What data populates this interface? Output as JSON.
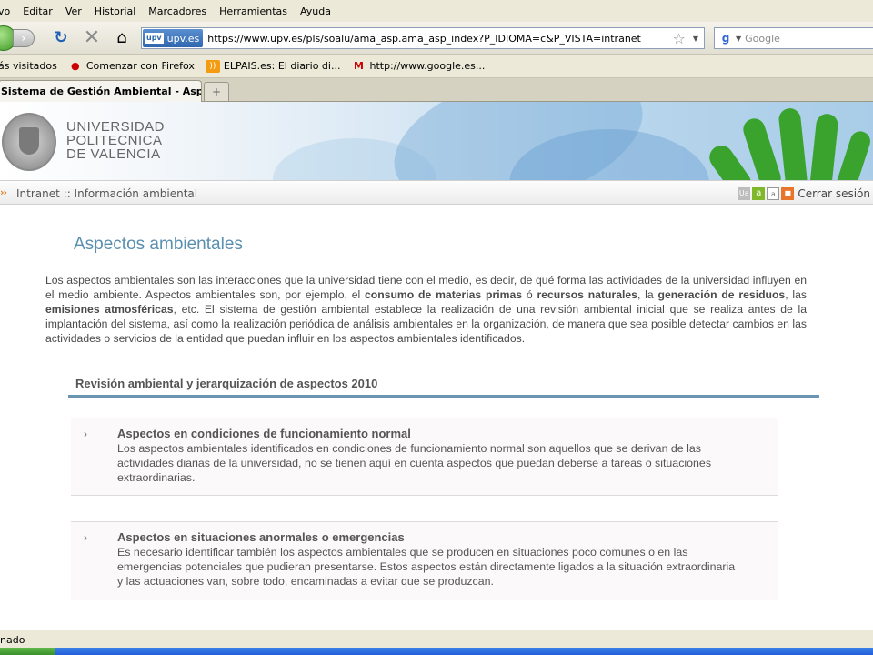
{
  "menu": [
    "vo",
    "Editar",
    "Ver",
    "Historial",
    "Marcadores",
    "Herramientas",
    "Ayuda"
  ],
  "navbar": {
    "site_badge": "upv.es",
    "site_badge_mini": "upv",
    "url": "https://www.upv.es/pls/soalu/ama_asp.ama_asp_index?P_IDIOMA=c&P_VISTA=intranet",
    "search_placeholder": "Google"
  },
  "bookmarks": [
    {
      "label": "ás visitados",
      "icon": "none"
    },
    {
      "label": "Comenzar con Firefox",
      "icon": "firefox-icon"
    },
    {
      "label": "ELPAIS.es: El diario di...",
      "icon": "rss-icon"
    },
    {
      "label": "http://www.google.es...",
      "icon": "gmail-icon"
    }
  ],
  "tab": {
    "title": "Sistema de Gestión Ambiental - Asp...",
    "new_tab": "+"
  },
  "header": {
    "logo_lines": [
      "UNIVERSIDAD",
      "POLITECNICA",
      "DE VALENCIA"
    ]
  },
  "breadcrumb": {
    "arrows": "››",
    "text": "Intranet :: Información ambiental",
    "tools": [
      "Ua",
      "a",
      "a"
    ],
    "logout": "Cerrar sesión"
  },
  "content": {
    "title": "Aspectos ambientales",
    "intro_parts": [
      "Los aspectos ambientales son las interacciones que la universidad tiene con el medio, es decir, de qué forma las actividades de la universidad influyen en el medio ambiente. Aspectos ambientales son, por ejemplo, el ",
      "consumo de materias primas",
      " ó ",
      "recursos naturales",
      ", la ",
      "generación de residuos",
      ", las ",
      "emisiones atmosféricas",
      ", etc. El sistema de gestión ambiental establece la realización de una revisión ambiental inicial que se realiza antes de la implantación del sistema, así como la realización periódica de análisis ambientales en la organización, de manera que sea posible detectar cambios en las actividades o servicios de la entidad que puedan influir en los aspectos ambientales identificados."
    ],
    "section_title": "Revisión ambiental y jerarquización de aspectos 2010",
    "cards": [
      {
        "title": "Aspectos en condiciones de funcionamiento normal",
        "body": "Los aspectos ambientales identificados en condiciones de funcionamiento normal son aquellos que se derivan de las actividades diarias de la universidad, no se tienen aquí en cuenta aspectos que puedan deberse a tareas o situaciones extraordinarias."
      },
      {
        "title": "Aspectos en situaciones anormales o emergencias",
        "body": "Es necesario identificar también los aspectos ambientales que se producen en situaciones poco comunes o en las emergencias potenciales que pudieran presentarse. Estos aspectos están directamente ligados a la situación extraordinaria y las actuaciones van, sobre todo, encaminadas a evitar que se produzcan."
      }
    ]
  },
  "status": {
    "text": "nado"
  },
  "colors": {
    "title_blue": "#5a8fb0",
    "section_rule": "#6a94b0",
    "brand_green": "#3aa32e",
    "crumb_orange": "#e07a20"
  }
}
